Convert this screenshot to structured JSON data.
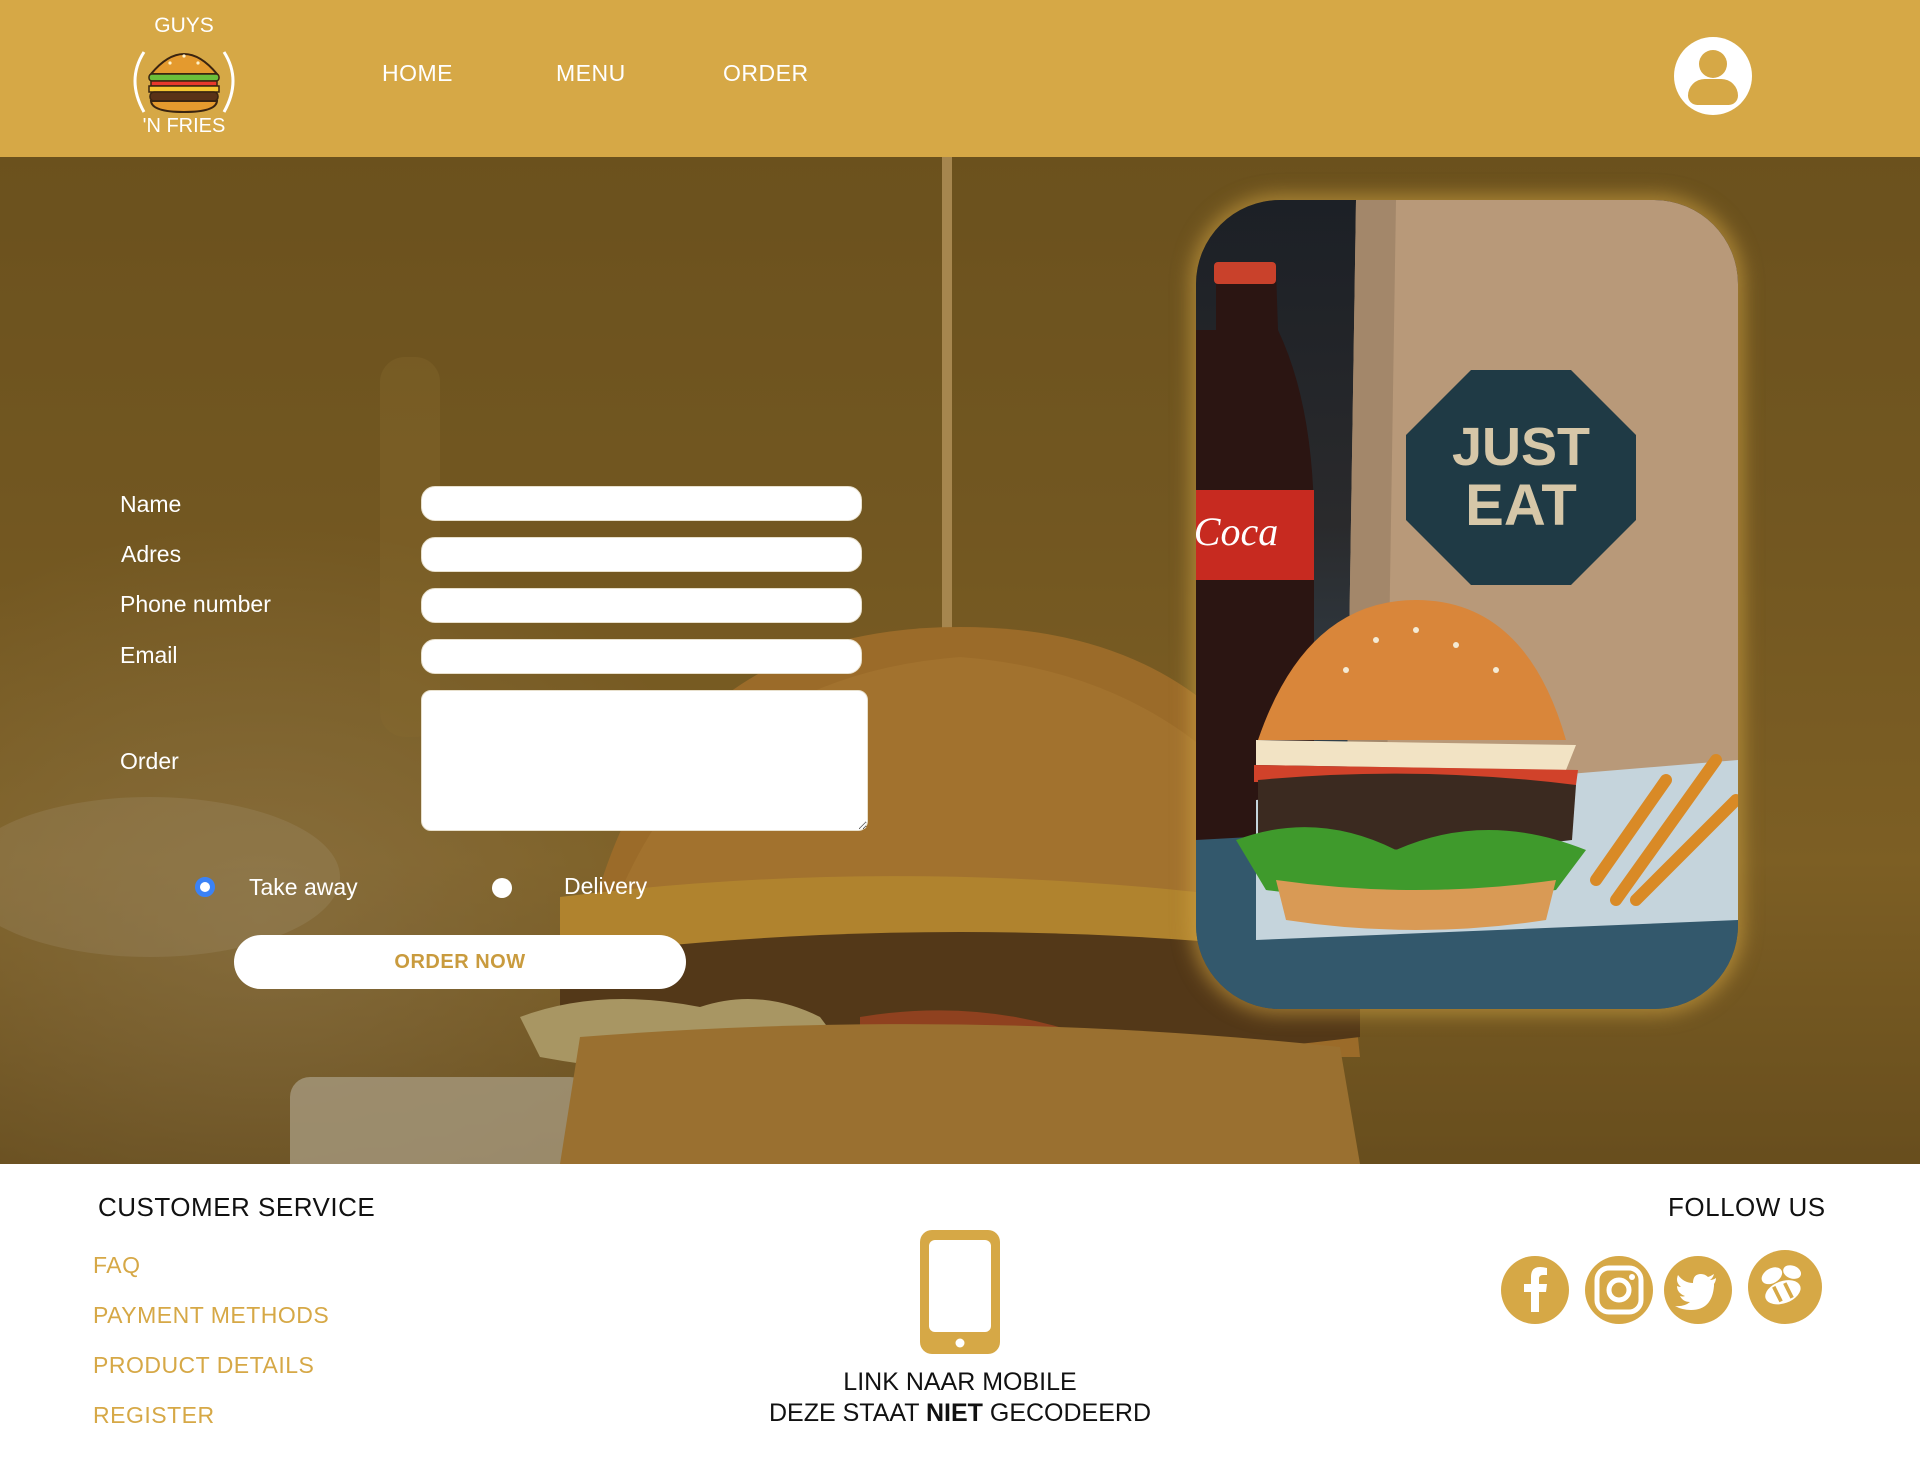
{
  "brand": {
    "logo_top": "GUYS",
    "logo_bottom": "'N FRIES",
    "accent_color": "#d6a846"
  },
  "nav": {
    "items": [
      {
        "label": "HOME"
      },
      {
        "label": "MENU"
      },
      {
        "label": "ORDER"
      }
    ],
    "account_icon": "user-icon"
  },
  "form": {
    "name_label": "Name",
    "address_label": "Adres",
    "phone_label": "Phone number",
    "email_label": "Email",
    "order_label": "Order",
    "name_value": "",
    "address_value": "",
    "phone_value": "",
    "email_value": "",
    "order_value": "",
    "options": [
      {
        "label": "Take away",
        "checked": true
      },
      {
        "label": "Delivery",
        "checked": false
      }
    ],
    "submit_label": "ORDER NOW"
  },
  "footer": {
    "customer_service": {
      "heading": "CUSTOMER SERVICE",
      "links": [
        "FAQ",
        "PAYMENT METHODS",
        "PRODUCT DETAILS",
        "REGISTER"
      ]
    },
    "mobile": {
      "icon": "smartphone-icon",
      "line1": "LINK NAAR MOBILE",
      "line2_pre": "DEZE STAAT",
      "line2_bold": "NIET",
      "line2_post": "GECODEERD"
    },
    "follow": {
      "heading": "FOLLOW US",
      "icons": [
        "facebook-icon",
        "instagram-icon",
        "twitter-icon",
        "thuisbezorgd-icon"
      ]
    }
  }
}
